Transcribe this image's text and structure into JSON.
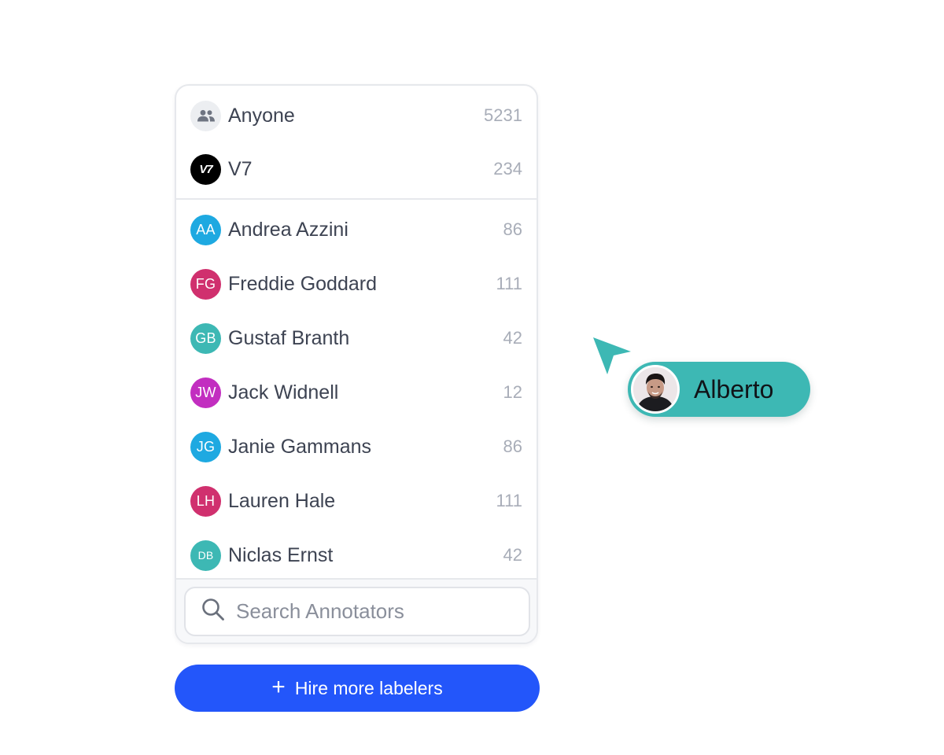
{
  "annotators_panel": {
    "groups": [
      {
        "label": "Anyone",
        "count": "5231",
        "icon": "people-icon",
        "avatar_color": "#eceef1"
      },
      {
        "label": "V7",
        "count": "234",
        "icon": "v7-logo-icon",
        "avatar_color": "#000000",
        "avatar_text": "V7"
      }
    ],
    "annotators": [
      {
        "initials": "AA",
        "name": "Andrea Azzini",
        "count": "86",
        "color": "#1ea9e1"
      },
      {
        "initials": "FG",
        "name": "Freddie Goddard",
        "count": "111",
        "color": "#d0306e"
      },
      {
        "initials": "GB",
        "name": "Gustaf Branth",
        "count": "42",
        "color": "#3db8b4"
      },
      {
        "initials": "JW",
        "name": "Jack Widnell",
        "count": "12",
        "color": "#c22ec0"
      },
      {
        "initials": "JG",
        "name": "Janie Gammans",
        "count": "86",
        "color": "#1ea9e1"
      },
      {
        "initials": "LH",
        "name": "Lauren Hale",
        "count": "111",
        "color": "#d0306e"
      },
      {
        "initials": "DB",
        "name": "Niclas Ernst",
        "count": "42",
        "color": "#3db8b4"
      }
    ],
    "search": {
      "placeholder": "Search Annotators",
      "value": ""
    }
  },
  "hire_button": {
    "label": "Hire more labelers",
    "icon": "plus-icon",
    "color": "#2356fa"
  },
  "cursor": {
    "user_name": "Alberto",
    "color": "#3db8b4",
    "icon": "cursor-arrow-icon"
  }
}
